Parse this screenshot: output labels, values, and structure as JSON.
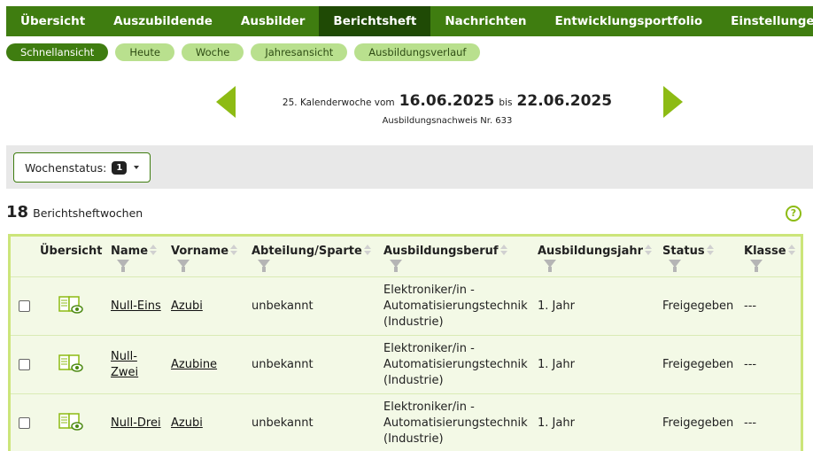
{
  "nav": {
    "items": [
      "Übersicht",
      "Auszubildende",
      "Ausbilder",
      "Berichtsheft",
      "Nachrichten",
      "Entwicklungsportfolio",
      "Einstellungen"
    ],
    "active": "Berichtsheft"
  },
  "subnav": {
    "items": [
      "Schnellansicht",
      "Heute",
      "Woche",
      "Jahresansicht",
      "Ausbildungsverlauf"
    ],
    "active": "Schnellansicht"
  },
  "week": {
    "prefix": "25. Kalenderwoche vom",
    "from": "16.06.2025",
    "connector": "bis",
    "to": "22.06.2025",
    "report_number": "Ausbildungsnachweis Nr. 633"
  },
  "status": {
    "label": "Wochenstatus:",
    "badge": "1"
  },
  "count": {
    "number": "18",
    "label": "Berichtsheftwochen"
  },
  "help_icon": "?",
  "table": {
    "columns": [
      "Übersicht",
      "Name",
      "Vorname",
      "Abteilung/Sparte",
      "Ausbildungsberuf",
      "Ausbildungsjahr",
      "Status",
      "Klasse"
    ],
    "rows": [
      {
        "name": "Null-Eins",
        "vorname": "Azubi",
        "abteilung": "unbekannt",
        "beruf": "Elektroniker/in - Automatisierungstechnik (Industrie)",
        "jahr": "1. Jahr",
        "status": "Freigegeben",
        "klasse": "---"
      },
      {
        "name": "Null-Zwei",
        "vorname": "Azubine",
        "abteilung": "unbekannt",
        "beruf": "Elektroniker/in - Automatisierungstechnik (Industrie)",
        "jahr": "1. Jahr",
        "status": "Freigegeben",
        "klasse": "---"
      },
      {
        "name": "Null-Drei",
        "vorname": "Azubi",
        "abteilung": "unbekannt",
        "beruf": "Elektroniker/in - Automatisierungstechnik (Industrie)",
        "jahr": "1. Jahr",
        "status": "Freigegeben",
        "klasse": "---"
      }
    ]
  },
  "colors": {
    "nav_bg": "#3f7d10",
    "nav_active": "#1f4a05",
    "pill": "#b9e08e",
    "arrow": "#8dbb14",
    "table_border": "#cce57a",
    "table_bg": "#f3f9e6"
  }
}
